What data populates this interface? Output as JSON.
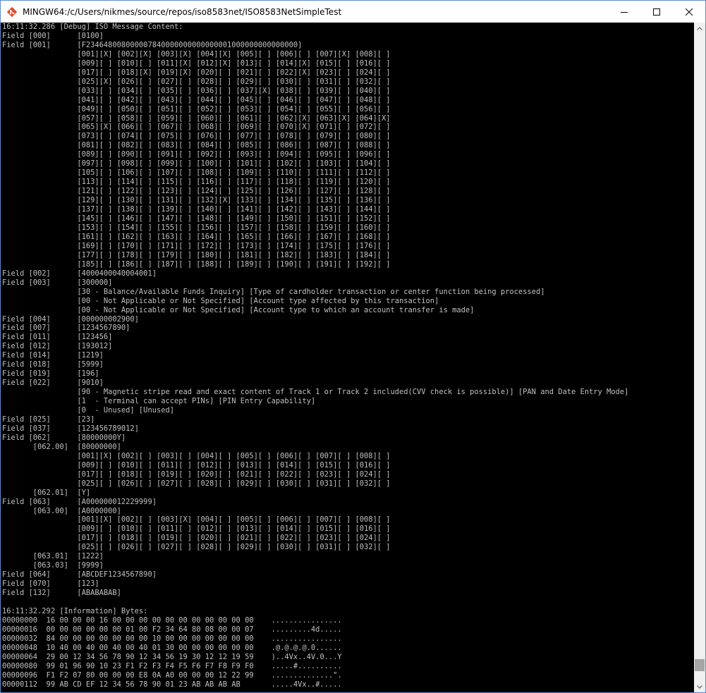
{
  "window": {
    "title": "MINGW64:/c/Users/nikmes/source/repos/iso8583net/ISO8583NetSimpleTest",
    "app_icon": "git-bash-icon",
    "controls": {
      "minimize": "minimize-icon",
      "maximize": "maximize-icon",
      "close": "close-icon"
    }
  },
  "colors": {
    "terminal_bg": "#000000",
    "terminal_fg": "#c0c0c0",
    "icon_red": "#e04a2a",
    "scroll_thumb": "#a6a6a6"
  },
  "scrollbar": {
    "position": 0.985
  },
  "terminal": {
    "lines": [
      "16:11:32.286 [Debug] ISO Message Content:",
      "Field [000]      [0100]",
      "Field [001]      [F234648008000007840000000000000001000000000000000]",
      "                 [001][X] [002][X] [003][X] [004][X] [005][ ] [006][ ] [007][X] [008][ ]",
      "                 [009][ ] [010][ ] [011][X] [012][X] [013][ ] [014][X] [015][ ] [016][ ]",
      "                 [017][ ] [018][X] [019][X] [020][ ] [021][ ] [022][X] [023][ ] [024][ ]",
      "                 [025][X] [026][ ] [027][ ] [028][ ] [029][ ] [030][ ] [031][ ] [032][ ]",
      "                 [033][ ] [034][ ] [035][ ] [036][ ] [037][X] [038][ ] [039][ ] [040][ ]",
      "                 [041][ ] [042][ ] [043][ ] [044][ ] [045][ ] [046][ ] [047][ ] [048][ ]",
      "                 [049][ ] [050][ ] [051][ ] [052][ ] [053][ ] [054][ ] [055][ ] [056][ ]",
      "                 [057][ ] [058][ ] [059][ ] [060][ ] [061][ ] [062][X] [063][X] [064][X]",
      "                 [065][X] [066][ ] [067][ ] [068][ ] [069][ ] [070][X] [071][ ] [072][ ]",
      "                 [073][ ] [074][ ] [075][ ] [076][ ] [077][ ] [078][ ] [079][ ] [080][ ]",
      "                 [081][ ] [082][ ] [083][ ] [084][ ] [085][ ] [086][ ] [087][ ] [088][ ]",
      "                 [089][ ] [090][ ] [091][ ] [092][ ] [093][ ] [094][ ] [095][ ] [096][ ]",
      "                 [097][ ] [098][ ] [099][ ] [100][ ] [101][ ] [102][ ] [103][ ] [104][ ]",
      "                 [105][ ] [106][ ] [107][ ] [108][ ] [109][ ] [110][ ] [111][ ] [112][ ]",
      "                 [113][ ] [114][ ] [115][ ] [116][ ] [117][ ] [118][ ] [119][ ] [120][ ]",
      "                 [121][ ] [122][ ] [123][ ] [124][ ] [125][ ] [126][ ] [127][ ] [128][ ]",
      "                 [129][ ] [130][ ] [131][ ] [132][X] [133][ ] [134][ ] [135][ ] [136][ ]",
      "                 [137][ ] [138][ ] [139][ ] [140][ ] [141][ ] [142][ ] [143][ ] [144][ ]",
      "                 [145][ ] [146][ ] [147][ ] [148][ ] [149][ ] [150][ ] [151][ ] [152][ ]",
      "                 [153][ ] [154][ ] [155][ ] [156][ ] [157][ ] [158][ ] [159][ ] [160][ ]",
      "                 [161][ ] [162][ ] [163][ ] [164][ ] [165][ ] [166][ ] [167][ ] [168][ ]",
      "                 [169][ ] [170][ ] [171][ ] [172][ ] [173][ ] [174][ ] [175][ ] [176][ ]",
      "                 [177][ ] [178][ ] [179][ ] [180][ ] [181][ ] [182][ ] [183][ ] [184][ ]",
      "                 [185][ ] [186][ ] [187][ ] [188][ ] [189][ ] [190][ ] [191][ ] [192][ ]",
      "Field [002]      [4000400040004001]",
      "Field [003]      [300000]",
      "                 [30 - Balance/Available Funds Inquiry] [Type of cardholder transaction or center function being processed]",
      "                 [00 - Not Applicable or Not Specified] [Account type affected by this transaction]",
      "                 [00 - Not Applicable or Not Specified] [Account type to which an account transfer is made]",
      "Field [004]      [000000002900]",
      "Field [007]      [1234567890]",
      "Field [011]      [123456]",
      "Field [012]      [193012]",
      "Field [014]      [1219]",
      "Field [018]      [5999]",
      "Field [019]      [196]",
      "Field [022]      [9010]",
      "                 [90 - Magnetic stripe read and exact content of Track 1 or Track 2 included(CVV check is possible)] [PAN and Date Entry Mode]",
      "                 [1  - Terminal can accept PINs] [PIN Entry Capability]",
      "                 [0  - Unused] [Unused]",
      "Field [025]      [23]",
      "Field [037]      [123456789012]",
      "Field [062]      [80000000Y]",
      "       [062.00]  [80000000]",
      "                 [001][X] [002][ ] [003][ ] [004][ ] [005][ ] [006][ ] [007][ ] [008][ ]",
      "                 [009][ ] [010][ ] [011][ ] [012][ ] [013][ ] [014][ ] [015][ ] [016][ ]",
      "                 [017][ ] [018][ ] [019][ ] [020][ ] [021][ ] [022][ ] [023][ ] [024][ ]",
      "                 [025][ ] [026][ ] [027][ ] [028][ ] [029][ ] [030][ ] [031][ ] [032][ ]",
      "       [062.01]  [Y]",
      "Field [063]      [A000000012229999]",
      "       [063.00]  [A0000000]",
      "                 [001][X] [002][ ] [003][X] [004][ ] [005][ ] [006][ ] [007][ ] [008][ ]",
      "                 [009][ ] [010][ ] [011][ ] [012][ ] [013][ ] [014][ ] [015][ ] [016][ ]",
      "                 [017][ ] [018][ ] [019][ ] [020][ ] [021][ ] [022][ ] [023][ ] [024][ ]",
      "                 [025][ ] [026][ ] [027][ ] [028][ ] [029][ ] [030][ ] [031][ ] [032][ ]",
      "       [063.01]  [1222]",
      "       [063.03]  [9999]",
      "Field [064]      [ABCDEF1234567890]",
      "Field [070]      [123]",
      "Field [132]      [ABABABAB]",
      "",
      "16:11:32.292 [Information] Bytes:",
      "00000000  16 00 00 00 16 00 00 00 00 00 00 00 00 00 00 00    ................",
      "00000016  00 00 00 00 00 00 01 00 F2 34 64 80 08 00 00 07    .........4d.....",
      "00000032  84 00 00 00 00 00 00 00 10 00 00 00 00 00 00 00    ................",
      "00000048  10 40 00 40 00 40 00 40 01 30 00 00 00 00 00 00    .@.@.@.@.0......",
      "00000064  29 00 12 34 56 78 90 12 34 56 19 30 12 12 19 59    )..4Vx..4V.0...Y",
      "00000080  99 01 96 90 10 23 F1 F2 F3 F4 F5 F6 F7 F8 F9 F0    .....#..........",
      "00000096  F1 F2 07 80 00 00 00 E8 0A A0 00 00 00 12 22 99    ..............\".",
      "00000112  99 AB CD EF 12 34 56 78 90 01 23 AB AB AB AB       .....4Vx..#....."
    ]
  }
}
